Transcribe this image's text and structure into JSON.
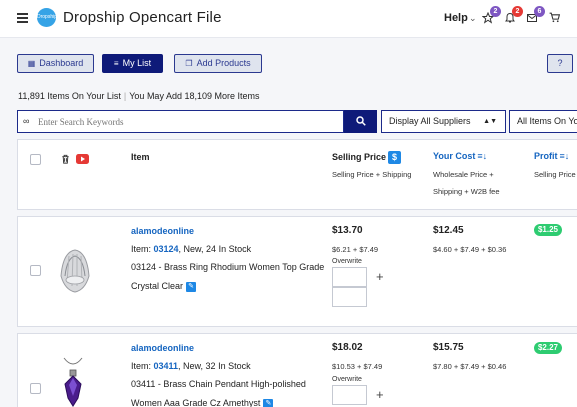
{
  "header": {
    "logo_text": "Dropship",
    "title": "Dropship Opencart File",
    "help_label": "Help",
    "badges": {
      "favorites": "2",
      "notifications": "2",
      "messages": "6"
    }
  },
  "toolbar": {
    "dashboard_label": "Dashboard",
    "mylist_label": "My List",
    "add_products_label": "Add Products",
    "help_label": "?"
  },
  "summary": {
    "items_text": "11,891 Items On Your List",
    "more_text": "You May Add 18,109 More Items"
  },
  "search": {
    "placeholder": "Enter Search Keywords",
    "suppliers_select": "Display All Suppliers",
    "items_select": "All Items On Your"
  },
  "table_header": {
    "item": "Item",
    "selling_price": "Selling Price",
    "selling_price_sub": "Selling Price + Shipping",
    "your_cost": "Your Cost",
    "your_cost_sub_1": "Wholesale Price +",
    "your_cost_sub_2": "Shipping + W2B fee",
    "profit": "Profit",
    "profit_sub": "Selling Price"
  },
  "products": [
    {
      "supplier": "alamodeonline",
      "item_prefix": "Item: ",
      "code": "03124",
      "stock": ", New, 24 In Stock",
      "description": "03124 - Brass Ring Rhodium Women Top Grade Crystal Clear",
      "selling_price": "$13.70",
      "selling_breakdown": "$6.21 + $7.49",
      "overwrite": "Overwrite",
      "cost": "$12.45",
      "cost_breakdown": "$4.60 + $7.49 + $0.36",
      "profit": "$1.25"
    },
    {
      "supplier": "alamodeonline",
      "item_prefix": "Item: ",
      "code": "03411",
      "stock": ", New, 32 In Stock",
      "description": "03411 - Brass Chain Pendant High-polished Women Aaa Grade Cz Amethyst",
      "selling_price": "$18.02",
      "selling_breakdown": "$10.53 + $7.49",
      "overwrite": "Overwrite",
      "cost": "$15.75",
      "cost_breakdown": "$7.80 + $7.49 + $0.46",
      "profit": "$2.27"
    }
  ],
  "colors": {
    "primary": "#0e1a79",
    "accent": "#1565c0",
    "profit": "#2ecc71"
  }
}
